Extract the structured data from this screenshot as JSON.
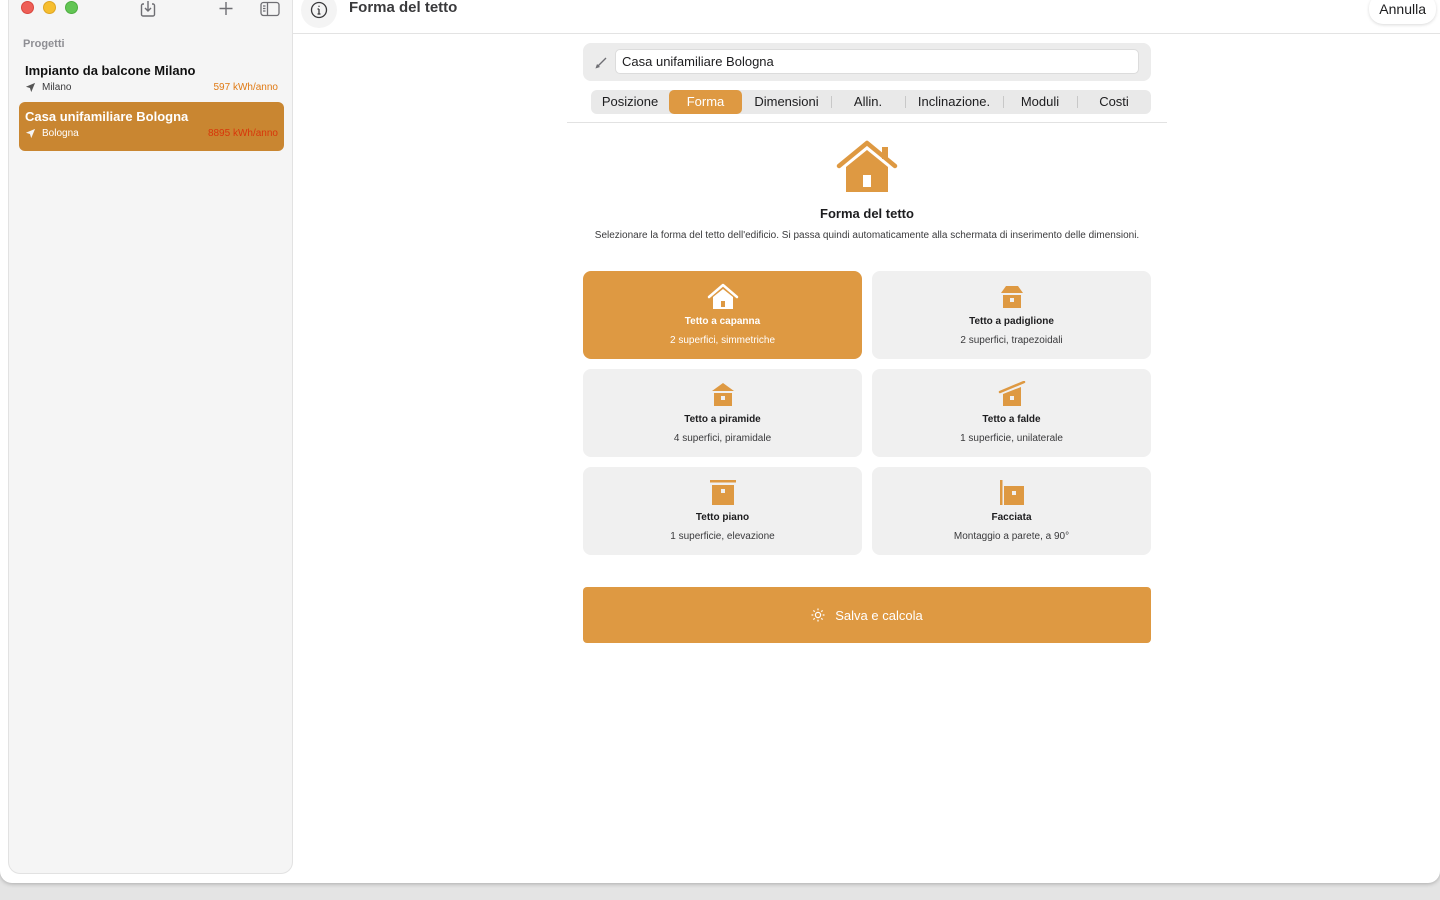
{
  "colors": {
    "accent": "#de9942",
    "accent_dark": "#c98631",
    "kwh": "#e07a14",
    "kwh_selected": "#d8360a"
  },
  "sidebar": {
    "section_label": "Progetti",
    "projects": [
      {
        "title": "Impianto da balcone Milano",
        "location": "Milano",
        "kwh": "597 kWh/anno",
        "selected": false
      },
      {
        "title": "Casa unifamiliare Bologna",
        "location": "Bologna",
        "kwh": "8895 kWh/anno",
        "selected": true
      }
    ]
  },
  "toolbar": {
    "title": "Forma del tetto",
    "cancel_label": "Annulla"
  },
  "editor": {
    "name_value": "Casa unifamiliare Bologna",
    "tabs": [
      {
        "label": "Posizione",
        "active": false
      },
      {
        "label": "Forma",
        "active": true
      },
      {
        "label": "Dimensioni",
        "active": false
      },
      {
        "label": "Allin.",
        "active": false
      },
      {
        "label": "Inclinazione.",
        "active": false
      },
      {
        "label": "Moduli",
        "active": false
      },
      {
        "label": "Costi",
        "active": false
      }
    ],
    "heading": "Forma del tetto",
    "description": "Selezionare la forma del tetto dell'edificio. Si passa quindi automaticamente alla schermata di inserimento delle dimensioni.",
    "roof_types": [
      {
        "title": "Tetto a capanna",
        "subtitle": "2 superfici, simmetriche",
        "icon": "gable-roof-icon",
        "selected": true
      },
      {
        "title": "Tetto a padiglione",
        "subtitle": "2 superfici, trapezoidali",
        "icon": "hip-roof-icon",
        "selected": false
      },
      {
        "title": "Tetto a piramide",
        "subtitle": "4 superfici, piramidale",
        "icon": "pyramid-roof-icon",
        "selected": false
      },
      {
        "title": "Tetto a falde",
        "subtitle": "1 superficie, unilaterale",
        "icon": "shed-roof-icon",
        "selected": false
      },
      {
        "title": "Tetto piano",
        "subtitle": "1 superficie, elevazione",
        "icon": "flat-roof-icon",
        "selected": false
      },
      {
        "title": "Facciata",
        "subtitle": "Montaggio a parete, a 90°",
        "icon": "facade-icon",
        "selected": false
      }
    ],
    "save_label": "Salva e calcola"
  }
}
